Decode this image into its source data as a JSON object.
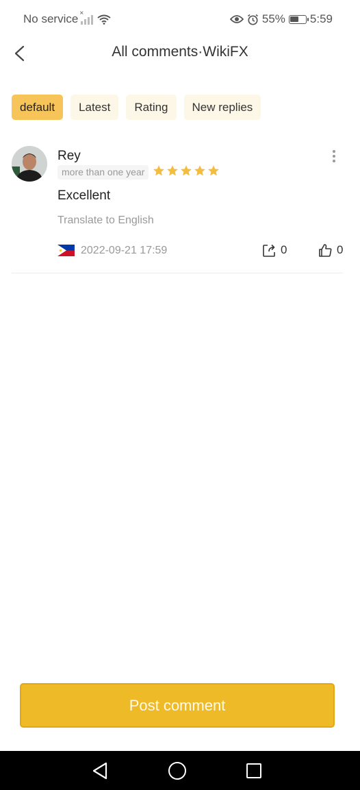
{
  "status": {
    "carrier": "No service",
    "battery": "55%",
    "battery_level": 0.55,
    "time": "5:59"
  },
  "header": {
    "title": "All comments·WikiFX",
    "back_icon": "chevron-left-icon"
  },
  "tabs": [
    {
      "label": "default",
      "active": true
    },
    {
      "label": "Latest",
      "active": false
    },
    {
      "label": "Rating",
      "active": false
    },
    {
      "label": "New replies",
      "active": false
    }
  ],
  "comment": {
    "user_name": "Rey",
    "user_tag": "more than one year",
    "rating": 5,
    "text": "Excellent",
    "translate_label": "Translate to English",
    "country_flag": "philippines-flag",
    "date": "2022-09-21 17:59",
    "share_count": "0",
    "like_count": "0"
  },
  "post_button": {
    "label": "Post comment"
  },
  "colors": {
    "accent": "#efba28",
    "active_tab": "#f6c458",
    "inactive_tab": "#fdf7e7",
    "star": "#f3bd3f"
  }
}
